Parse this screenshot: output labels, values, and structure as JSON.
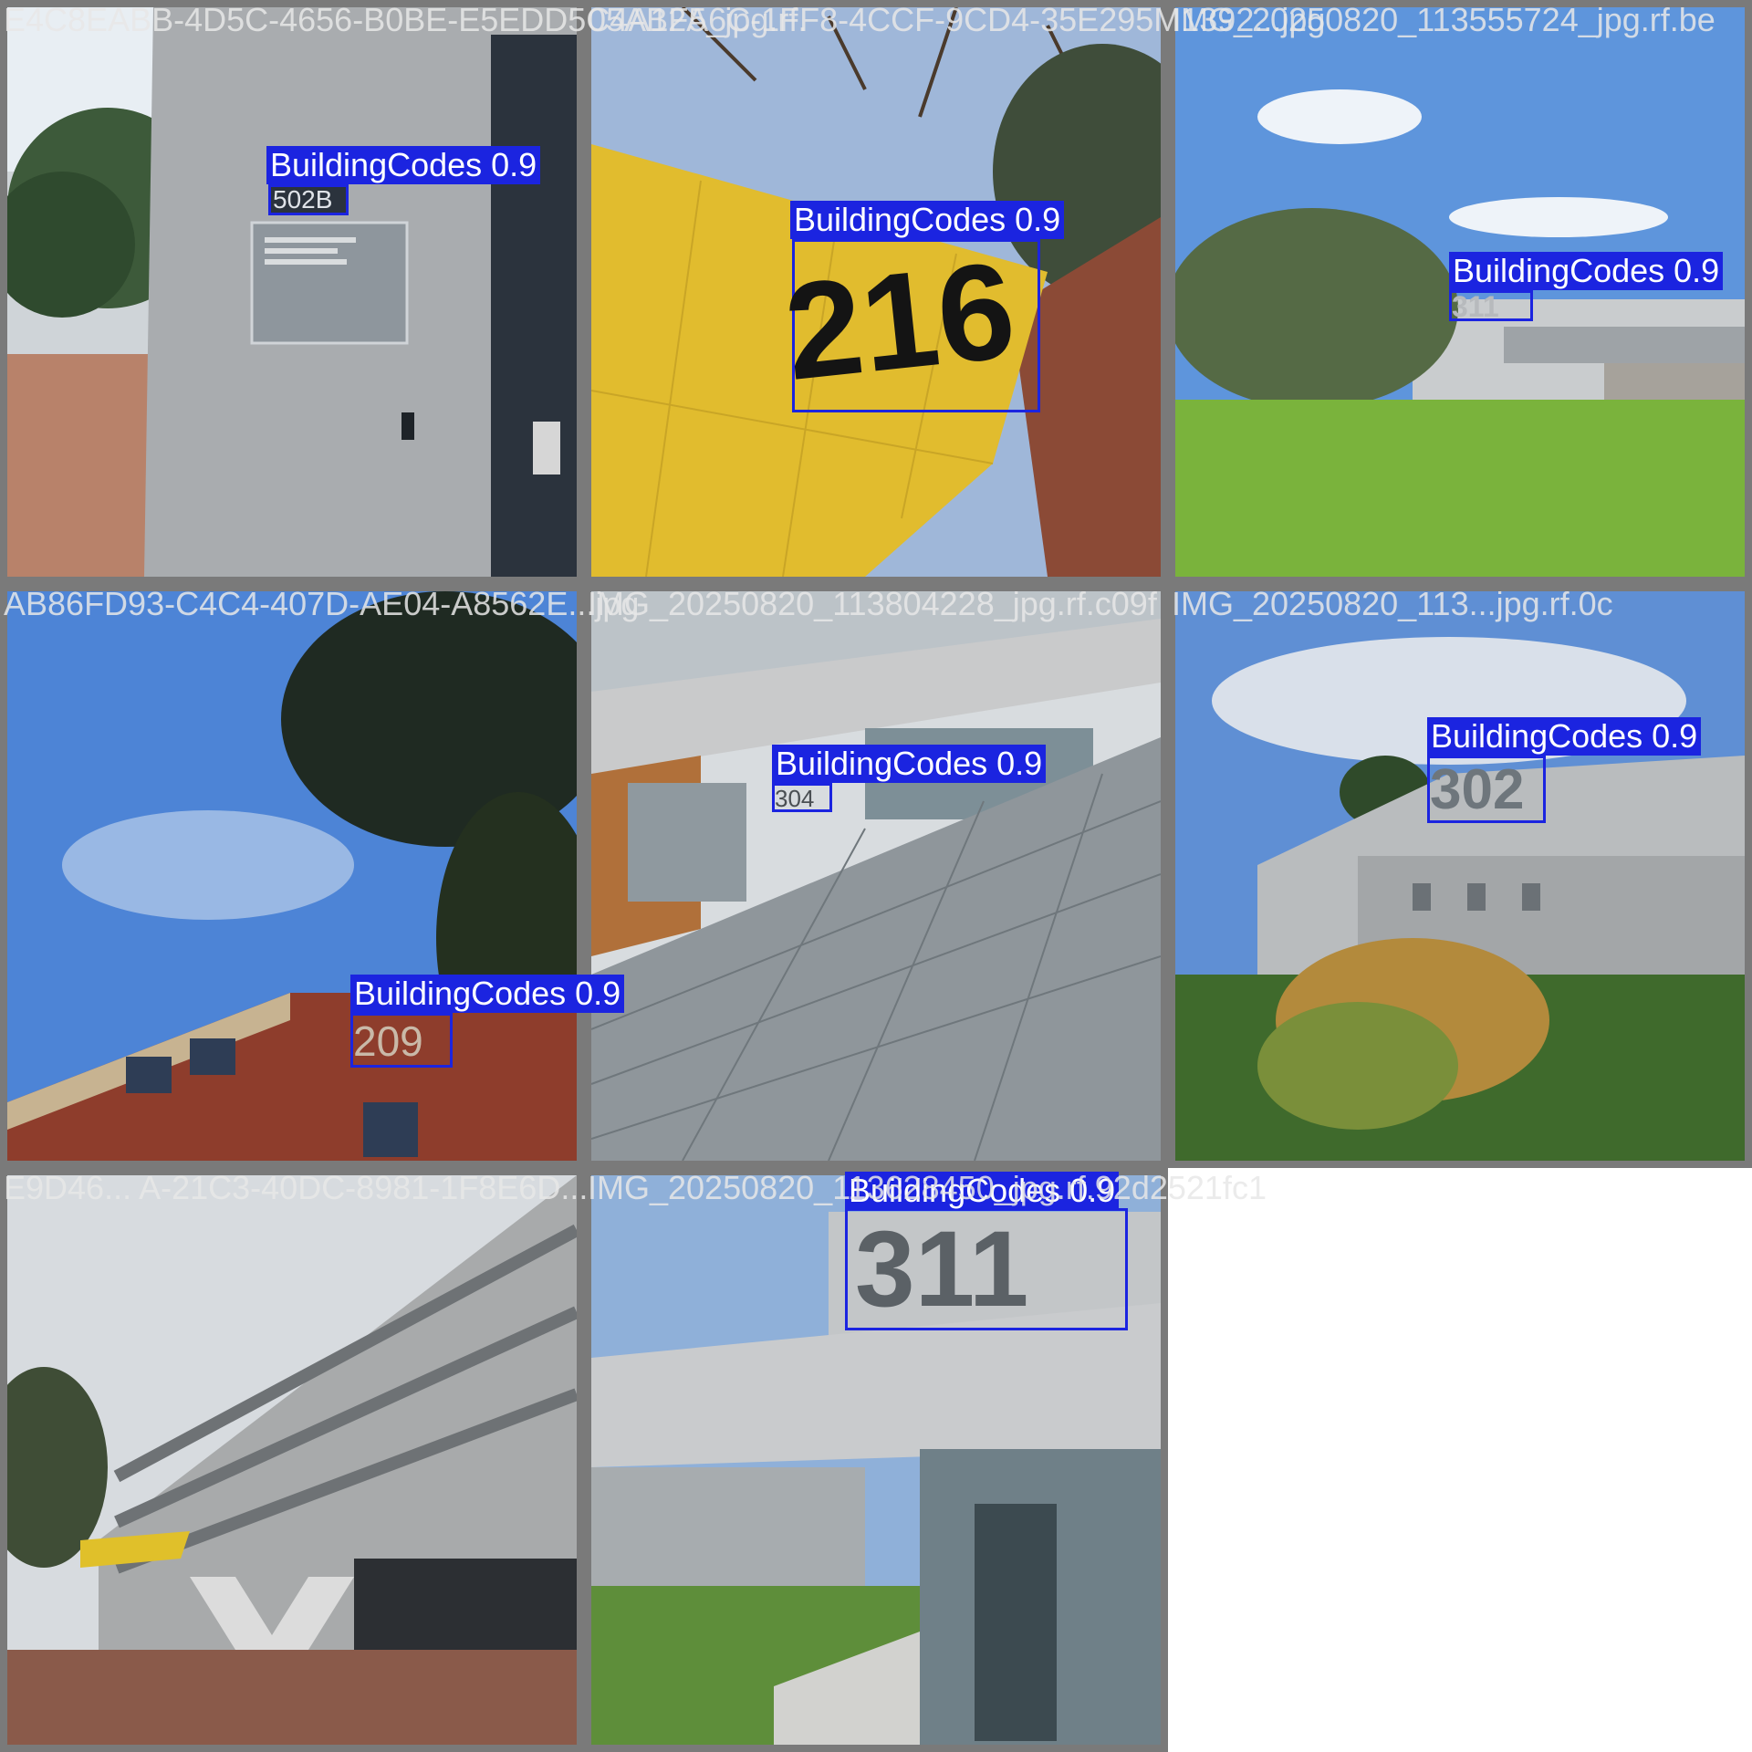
{
  "colors": {
    "box": "#1b24e0",
    "label_text": "#ffffff",
    "filename_text": "#e8e8e8",
    "tile_border": "#7a7a7a"
  },
  "tiles": [
    {
      "filename": "E4C8EABB-4D5C-4656-B0BE-E5EDD5C4A1F5_jpg.rf.",
      "detections": [
        {
          "label": "BuildingCodes 0.9",
          "code": "502B"
        }
      ]
    },
    {
      "filename": "05AB2A6C-1FF8-4CCF-9CD4-35E295M1392...jpg",
      "detections": [
        {
          "label": "BuildingCodes 0.9",
          "code": "216"
        }
      ]
    },
    {
      "filename": "IMG_20250820_113555724_jpg.rf.be",
      "detections": [
        {
          "label": "BuildingCodes 0.9",
          "code": "311"
        }
      ]
    },
    {
      "filename": "AB86FD93-C4C4-407D-AE04-A8562E...jpg",
      "detections": [
        {
          "label": "BuildingCodes 0.9",
          "code": "209"
        }
      ]
    },
    {
      "filename": "IMG_20250820_113804228_jpg.rf.c09f",
      "detections": [
        {
          "label": "BuildingCodes 0.9",
          "code": "304"
        }
      ]
    },
    {
      "filename": "IMG_20250820_113...jpg.rf.0c",
      "detections": [
        {
          "label": "BuildingCodes 0.9",
          "code": "302"
        }
      ]
    },
    {
      "filename": "E9D46... A-21C3-40DC-8981-1F8E6D...",
      "detections": []
    },
    {
      "filename": "IMG_20250820_113628450_jpg.rf.92d2521fc1",
      "detections": [
        {
          "label": "BuildingCodes 0.9",
          "code": "311"
        }
      ]
    }
  ]
}
